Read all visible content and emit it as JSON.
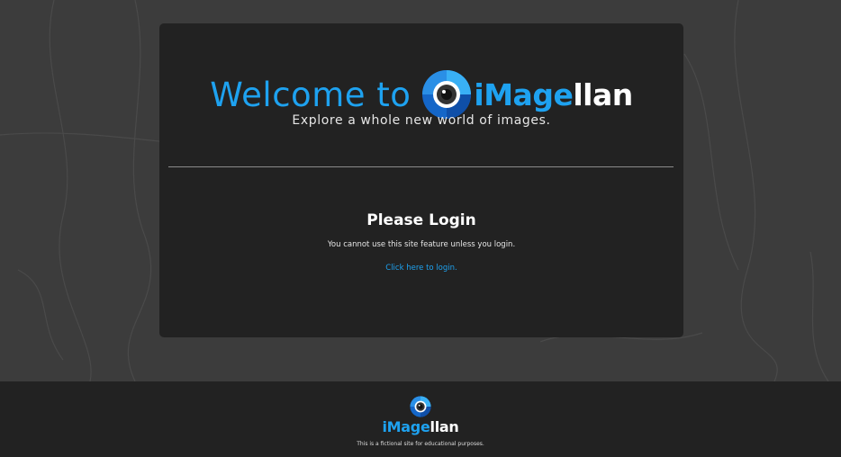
{
  "welcome": {
    "prefix": "Welcome to",
    "brand_part1": "iMage",
    "brand_part2": "llan"
  },
  "tagline": "Explore a whole new world of images.",
  "login": {
    "title": "Please Login",
    "message": "You cannot use this site feature unless you login.",
    "link_label": "Click here to login."
  },
  "footer": {
    "brand_part1": "iMage",
    "brand_part2": "llan",
    "note": "This is a fictional site for educational purposes."
  },
  "colors": {
    "accent": "#1ea2f0",
    "panel": "#222222",
    "background": "#3c3c3c"
  },
  "icons": {
    "logo": "camera-lens-icon"
  }
}
